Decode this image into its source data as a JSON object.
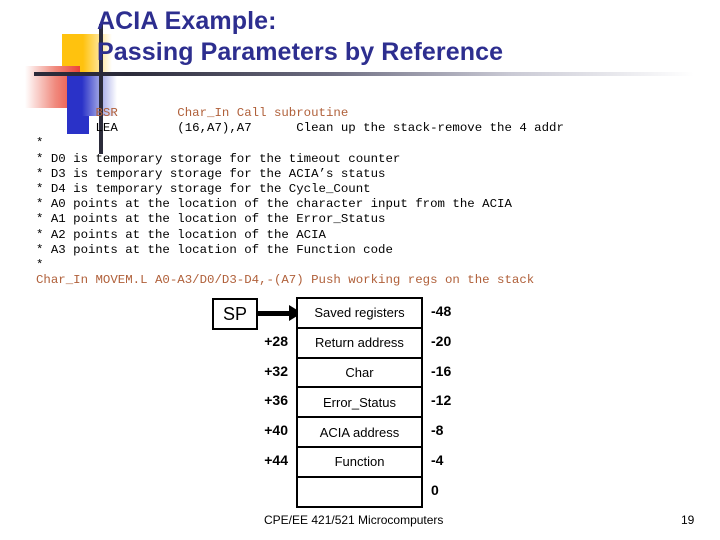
{
  "slide": {
    "title_line1": "ACIA Example:",
    "title_line2": "Passing Parameters by Reference",
    "title_color": "#2D2E8F"
  },
  "code_block": {
    "accent_color": "#B0603A",
    "lines": [
      {
        "text": "        BSR        Char_In Call subroutine",
        "accent": true
      },
      {
        "text": "        LEA        (16,A7),A7      Clean up the stack-remove the 4 addr",
        "accent": false
      },
      {
        "text": "*",
        "accent": false
      },
      {
        "text": "* D0 is temporary storage for the timeout counter",
        "accent": false
      },
      {
        "text": "* D3 is temporary storage for the ACIA’s status",
        "accent": false
      },
      {
        "text": "* D4 is temporary storage for the Cycle_Count",
        "accent": false
      },
      {
        "text": "* A0 points at the location of the character input from the ACIA",
        "accent": false
      },
      {
        "text": "* A1 points at the location of the Error_Status",
        "accent": false
      },
      {
        "text": "* A2 points at the location of the ACIA",
        "accent": false
      },
      {
        "text": "* A3 points at the location of the Function code",
        "accent": false
      },
      {
        "text": "*",
        "accent": false
      },
      {
        "text": "Char_In MOVEM.L A0-A3/D0/D3-D4,-(A7) Push working regs on the stack",
        "accent": true
      }
    ]
  },
  "stack_diagram": {
    "sp_label": "SP",
    "rows": [
      {
        "left_offset": "",
        "label": "Saved registers",
        "right_offset": "-48"
      },
      {
        "left_offset": "+28",
        "label": "Return address",
        "right_offset": "-20"
      },
      {
        "left_offset": "+32",
        "label": "Char",
        "right_offset": "-16"
      },
      {
        "left_offset": "+36",
        "label": "Error_Status",
        "right_offset": "-12"
      },
      {
        "left_offset": "+40",
        "label": "ACIA address",
        "right_offset": "-8"
      },
      {
        "left_offset": "+44",
        "label": "Function",
        "right_offset": "-4"
      },
      {
        "left_offset": "",
        "label": "",
        "right_offset": "0"
      }
    ]
  },
  "footer": {
    "course": "CPE/EE 421/521 Microcomputers",
    "page_number": "19"
  }
}
